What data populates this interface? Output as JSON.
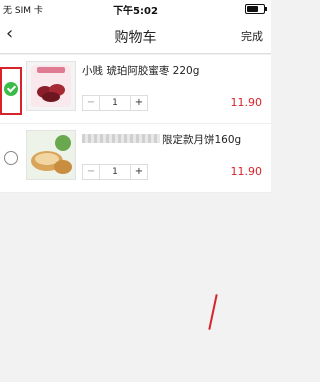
{
  "status_bar": {
    "carrier": "无 SIM 卡",
    "time": "下午5:02",
    "battery_level": 0.7
  },
  "nav": {
    "back_icon": "chevron-left-icon",
    "title": "购物车",
    "done_label": "完成"
  },
  "cart": {
    "items": [
      {
        "name": "小贱 琥珀阿胶蜜枣 220g",
        "quantity": "1",
        "price": "11.90",
        "checked": true,
        "minus": "−",
        "plus": "+"
      },
      {
        "name": "限定款月饼160g",
        "quantity": "1",
        "price": "11.90",
        "checked": false,
        "minus": "−",
        "plus": "+"
      }
    ]
  },
  "colors": {
    "accent_red": "#d9232a",
    "check_green": "#3dbb4a"
  }
}
